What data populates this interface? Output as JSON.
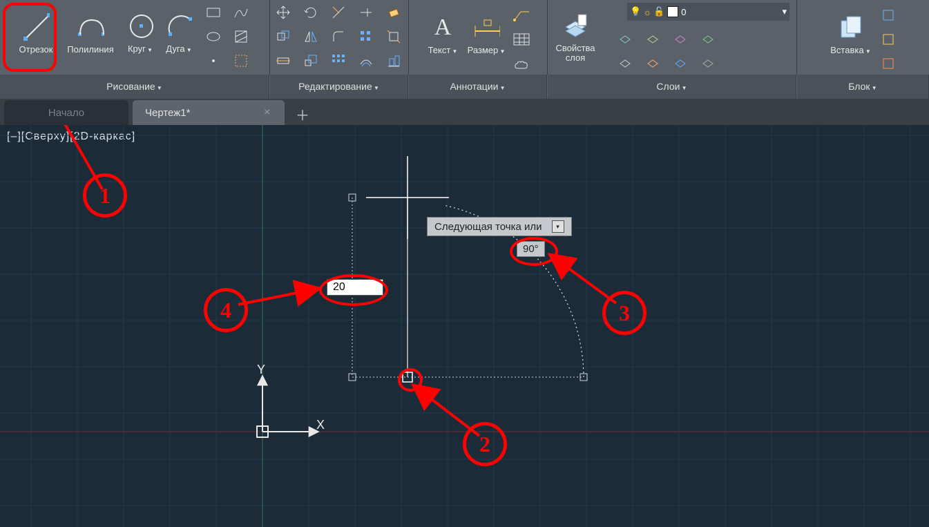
{
  "ribbon": {
    "draw": {
      "line": "Отрезок",
      "polyline": "Полилиния",
      "circle": "Круг",
      "arc": "Дуга",
      "title": "Рисование"
    },
    "modify": {
      "title": "Редактирование"
    },
    "annotation": {
      "text": "Текст",
      "dimension": "Размер",
      "title": "Аннотации"
    },
    "layers": {
      "props": "Свойства\nслоя",
      "current": "0",
      "title": "Слои"
    },
    "block": {
      "insert": "Вставка",
      "title": "Блок"
    }
  },
  "tabs": {
    "start": "Начало",
    "drawing": "Чертеж1*"
  },
  "viewport_label": "[–][Сверху][2D-каркас]",
  "tooltip_text": "Следующая точка или",
  "input_length": "20",
  "input_angle": "90°",
  "callouts": {
    "c1": "1",
    "c2": "2",
    "c3": "3",
    "c4": "4"
  }
}
